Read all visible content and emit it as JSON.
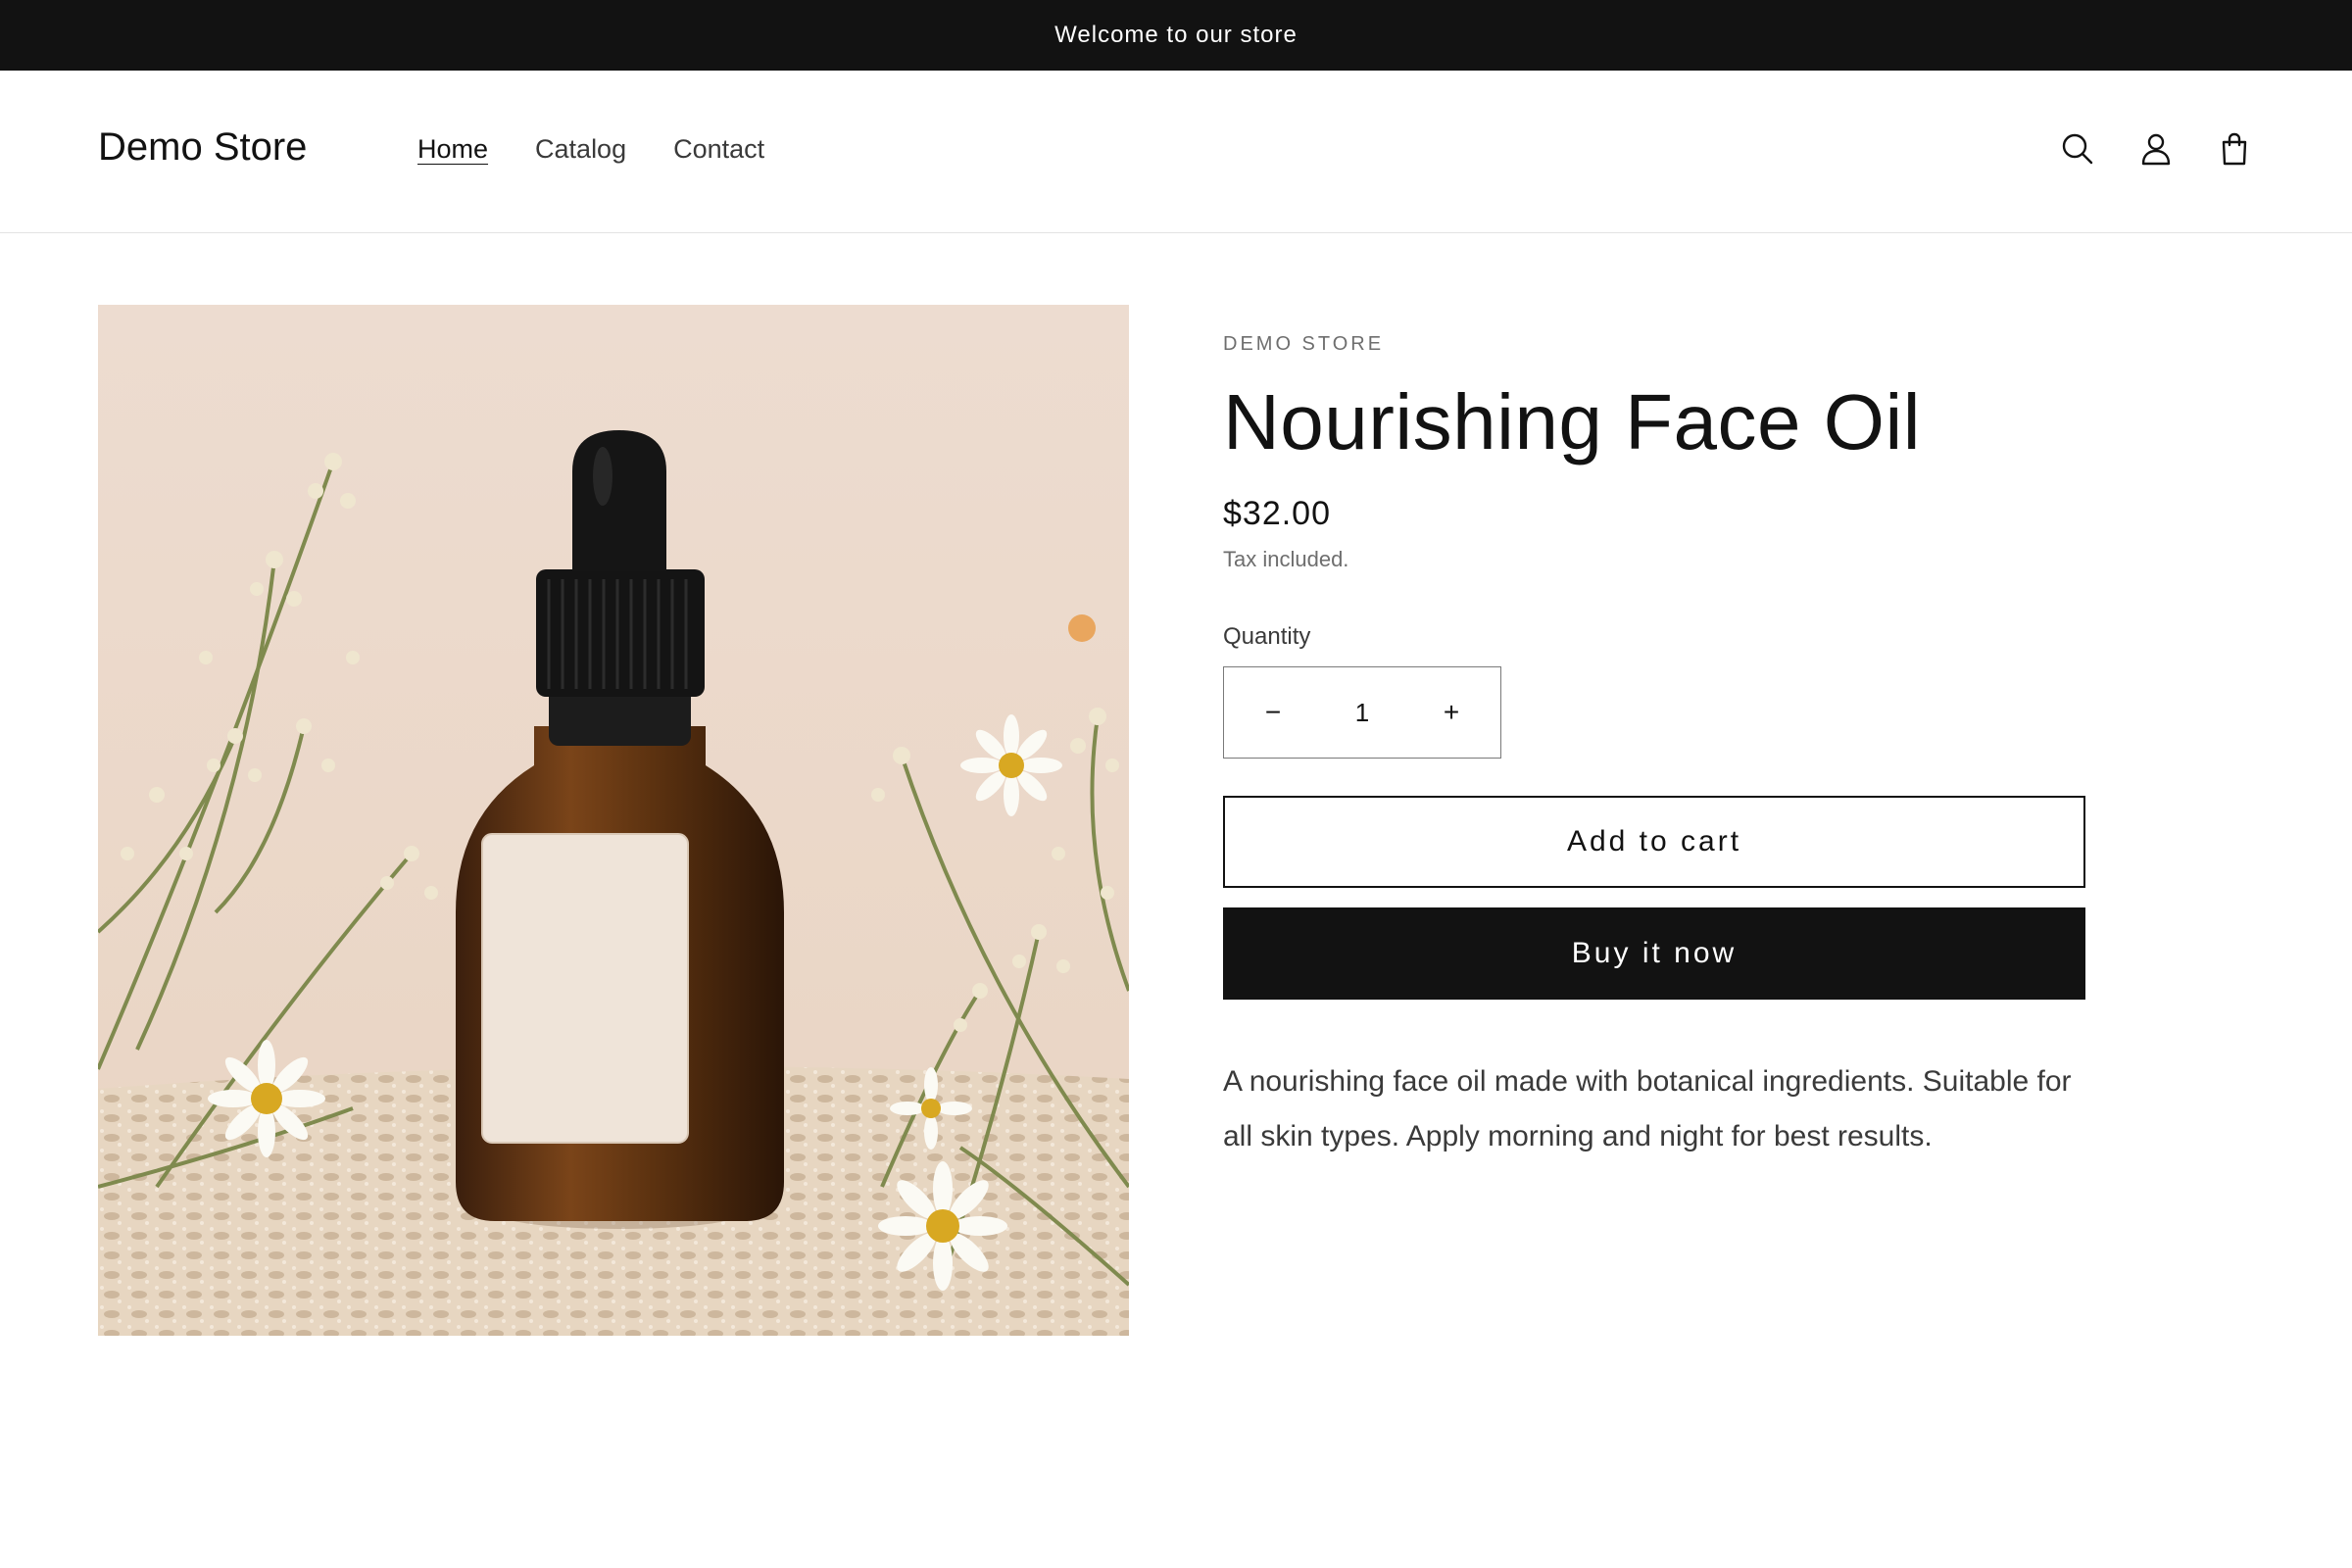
{
  "announcement": {
    "text": "Welcome to our store"
  },
  "header": {
    "logo": "Demo Store",
    "nav": [
      {
        "label": "Home",
        "active": true
      },
      {
        "label": "Catalog",
        "active": false
      },
      {
        "label": "Contact",
        "active": false
      }
    ],
    "icons": [
      "search-icon",
      "account-icon",
      "cart-icon"
    ]
  },
  "product": {
    "vendor": "DEMO STORE",
    "title": "Nourishing Face Oil",
    "price": "$32.00",
    "tax_note": "Tax included.",
    "quantity_label": "Quantity",
    "quantity_value": "1",
    "minus_symbol": "−",
    "plus_symbol": "+",
    "add_to_cart_label": "Add to cart",
    "buy_now_label": "Buy it now",
    "description": "A nourishing face oil made with botanical ingredients. Suitable for all skin types. Apply morning and night for best results."
  },
  "colors": {
    "announcement_bg": "#121212",
    "text": "#121212",
    "muted": "#6e6e6e",
    "button_solid": "#121212"
  }
}
